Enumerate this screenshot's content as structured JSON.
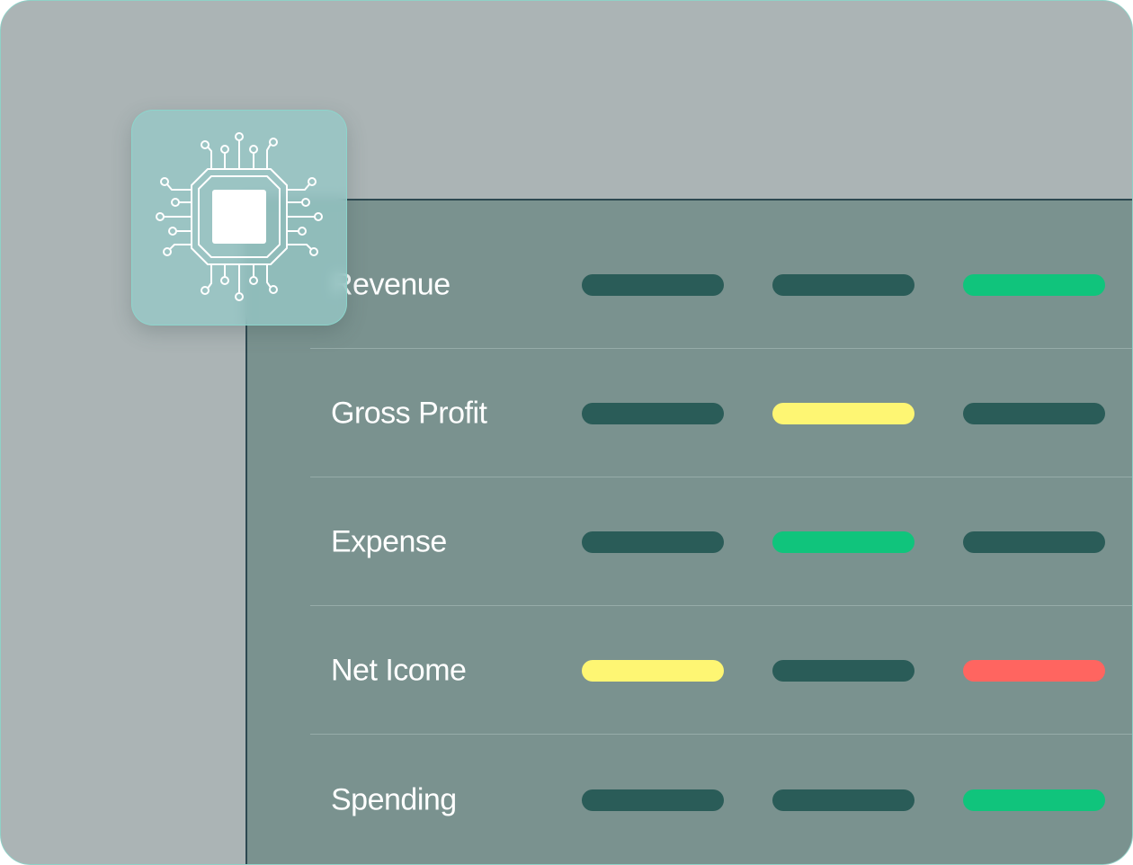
{
  "colors": {
    "neutral": "#2a5c58",
    "green": "#10c47c",
    "yellow": "#fef673",
    "red": "#ff6560"
  },
  "chip_card": {
    "icon": "circuit-chip-icon"
  },
  "rows": [
    {
      "label": "Revenue",
      "statuses": [
        "neutral",
        "neutral",
        "green"
      ]
    },
    {
      "label": "Gross Profit",
      "statuses": [
        "neutral",
        "yellow",
        "neutral"
      ]
    },
    {
      "label": "Expense",
      "statuses": [
        "neutral",
        "green",
        "neutral"
      ]
    },
    {
      "label": "Net Icome",
      "statuses": [
        "yellow",
        "neutral",
        "red"
      ]
    },
    {
      "label": "Spending",
      "statuses": [
        "neutral",
        "neutral",
        "green"
      ]
    }
  ]
}
